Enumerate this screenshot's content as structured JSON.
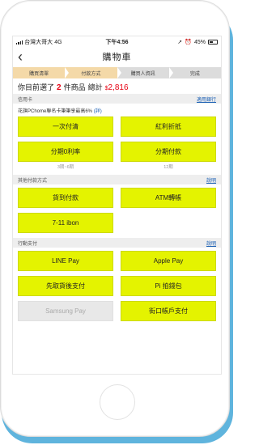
{
  "status_bar": {
    "carrier": "台灣大哥大",
    "network": "4G",
    "time": "下午4:56",
    "battery": "45%"
  },
  "header": {
    "back_icon": "chevron-left-icon",
    "title": "購物車"
  },
  "steps": [
    {
      "label": "購買清單",
      "state": "done"
    },
    {
      "label": "付款方式",
      "state": "active"
    },
    {
      "label": "購買人資訊",
      "state": "todo"
    },
    {
      "label": "完成",
      "state": "todo"
    }
  ],
  "summary": {
    "prefix": "你目前選了",
    "count": "2",
    "unit": "件商品",
    "total_label": "總計",
    "currency": "$",
    "total": "2,816"
  },
  "credit_card": {
    "section_label": "信用卡",
    "link": "適用銀行",
    "note_text": "花旗PChome聯名卡筆筆享最高6%",
    "note_paren_open": "(",
    "note_link": "詳",
    "note_paren_close": ")",
    "buttons": [
      "一次付清",
      "紅利折抵",
      "分期0利率",
      "分期付款"
    ],
    "subtexts": [
      "3期~6期",
      "12期"
    ]
  },
  "other_payment": {
    "section_label": "其他付款方式",
    "link": "說明",
    "buttons": [
      "貨到付款",
      "ATM轉帳",
      "7-11 ibon"
    ]
  },
  "mobile_payment": {
    "section_label": "行動支付",
    "link": "說明",
    "buttons": [
      {
        "label": "LINE Pay",
        "enabled": true
      },
      {
        "label": "Apple Pay",
        "enabled": true
      },
      {
        "label": "先取貨後支付",
        "enabled": true
      },
      {
        "label": "Pi 拍錢包",
        "enabled": true
      },
      {
        "label": "Samsung Pay",
        "enabled": false
      },
      {
        "label": "街口帳戶支付",
        "enabled": true
      }
    ]
  },
  "colors": {
    "button": "#e4f300",
    "accent_red": "#e60012",
    "step_done": "#f4d9a8",
    "step_todo": "#dcdcdc",
    "link_blue": "#1a5fb4",
    "frame_shadow": "#5fb4dd"
  }
}
